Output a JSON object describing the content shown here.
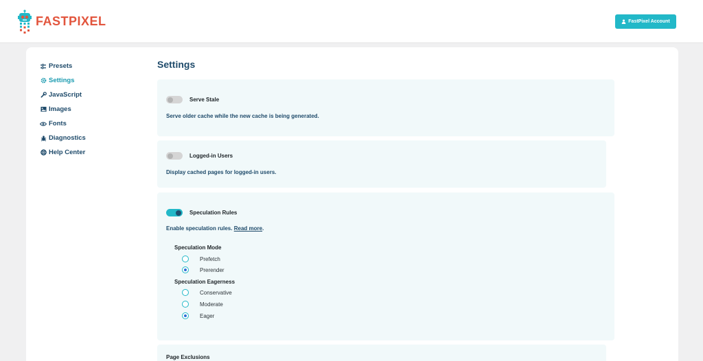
{
  "header": {
    "logo_text_1": "FAST",
    "logo_text_2": "PIXEL",
    "account_button": "FastPixel Account",
    "brand_color": "#22b8c8"
  },
  "sidebar": {
    "items": [
      {
        "label": "Presets",
        "icon": "presets-icon",
        "active": false
      },
      {
        "label": "Settings",
        "icon": "gear-icon",
        "active": true
      },
      {
        "label": "JavaScript",
        "icon": "wrench-icon",
        "active": false
      },
      {
        "label": "Images",
        "icon": "image-icon",
        "active": false
      },
      {
        "label": "Fonts",
        "icon": "eye-icon",
        "active": false
      },
      {
        "label": "Diagnostics",
        "icon": "bug-icon",
        "active": false
      },
      {
        "label": "Help Center",
        "icon": "lifebuoy-icon",
        "active": false
      }
    ]
  },
  "main": {
    "title": "Settings",
    "serve_stale": {
      "label": "Serve Stale",
      "enabled": false,
      "description": "Serve older cache while the new cache is being generated."
    },
    "logged_in_users": {
      "label": "Logged-in Users",
      "enabled": false,
      "description": "Display cached pages for logged-in users."
    },
    "speculation_rules": {
      "label": "Speculation Rules",
      "enabled": true,
      "description": "Enable speculation rules.",
      "link_text": "Read more",
      "period": ".",
      "mode": {
        "label": "Speculation Mode",
        "options": [
          "Prefetch",
          "Prerender"
        ],
        "selected": "Prerender"
      },
      "eagerness": {
        "label": "Speculation Eagerness",
        "options": [
          "Conservative",
          "Moderate",
          "Eager"
        ],
        "selected": "Eager"
      }
    },
    "page_exclusions": {
      "label": "Page Exclusions"
    }
  }
}
